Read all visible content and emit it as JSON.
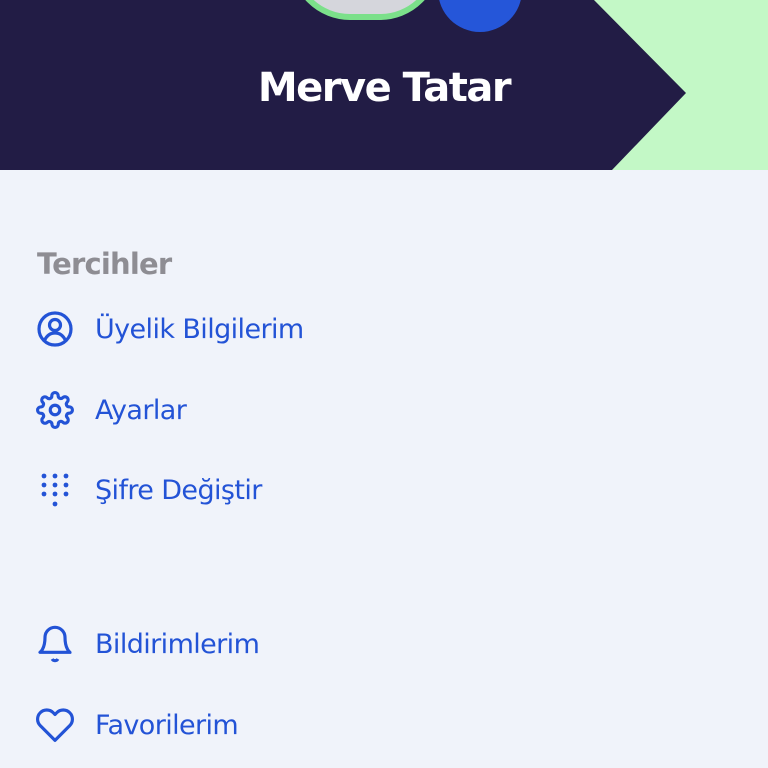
{
  "profile": {
    "name": "Merve Tatar",
    "camera_icon": "camera-icon"
  },
  "colors": {
    "header_bg": "#221C45",
    "accent_green": "#C3F8C6",
    "primary_blue": "#2353D6",
    "section_title": "#8E8D93",
    "page_bg": "#F0F3FA"
  },
  "preferences": {
    "title": "Tercihler",
    "items": [
      {
        "label": "Üyelik Bilgilerim",
        "icon": "user-circle-icon"
      },
      {
        "label": "Ayarlar",
        "icon": "gear-icon"
      },
      {
        "label": "Şifre Değiştir",
        "icon": "keypad-icon"
      }
    ]
  },
  "other": {
    "items": [
      {
        "label": "Bildirimlerim",
        "icon": "bell-icon"
      },
      {
        "label": "Favorilerim",
        "icon": "heart-icon"
      }
    ]
  }
}
